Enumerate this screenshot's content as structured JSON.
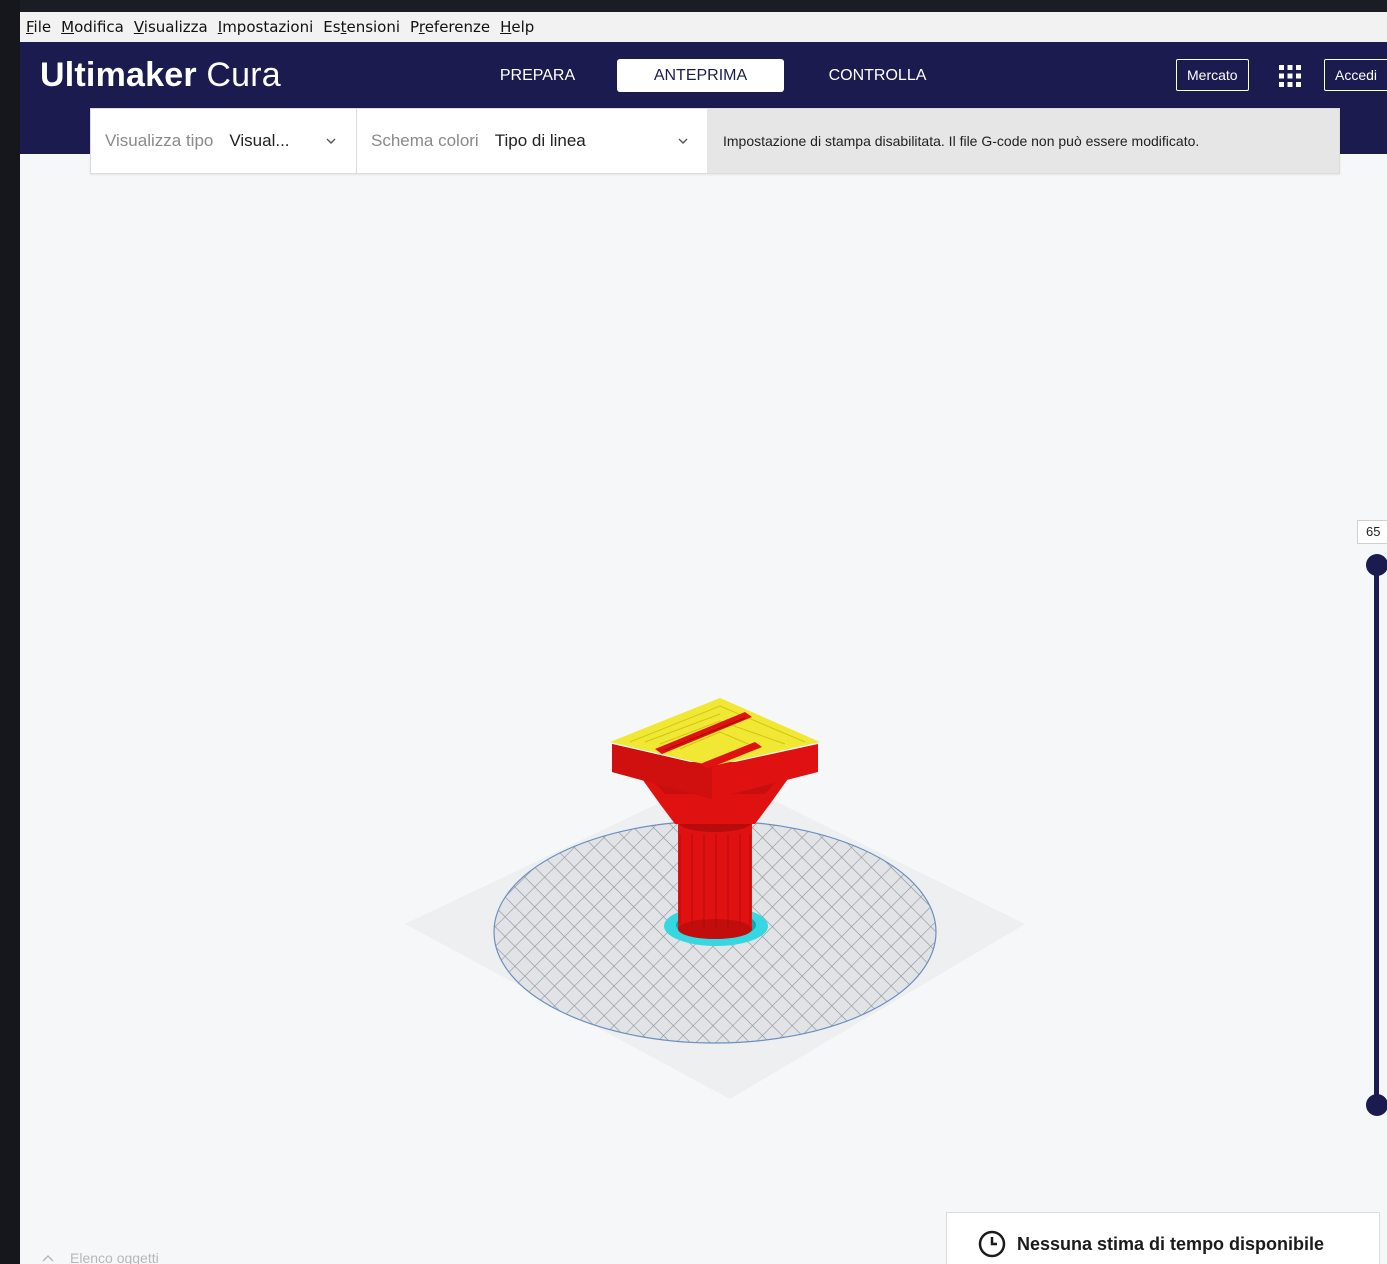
{
  "menubar": {
    "items": [
      {
        "mnemonic": "F",
        "rest": "ile"
      },
      {
        "mnemonic": "M",
        "rest": "odifica"
      },
      {
        "mnemonic": "V",
        "rest": "isualizza"
      },
      {
        "mnemonic": "I",
        "rest": "mpostazioni"
      },
      {
        "pre": "Es",
        "mnemonic": "t",
        "rest": "ensioni"
      },
      {
        "pre": "P",
        "mnemonic": "r",
        "rest": "eferenze"
      },
      {
        "mnemonic": "H",
        "rest": "elp"
      }
    ]
  },
  "header": {
    "logo_bold": "Ultimaker",
    "logo_light": "Cura",
    "stages": [
      "PREPARA",
      "ANTEPRIMA",
      "CONTROLLA"
    ],
    "active_stage": "ANTEPRIMA",
    "marketplace_label": "Mercato",
    "signin_label": "Accedi"
  },
  "view_toolbar": {
    "view_type_label": "Visualizza tipo",
    "view_type_value": "Visual...",
    "color_scheme_label": "Schema colori",
    "color_scheme_value": "Tipo di linea",
    "message": "Impostazione di stampa disabilitata. Il file G-code non può essere modificato."
  },
  "layer_slider": {
    "layer_value": "65"
  },
  "object_list": {
    "label": "Elenco oggetti"
  },
  "print_estimate": {
    "text": "Nessuna stima di tempo disponibile"
  },
  "colors": {
    "header_bg": "#1b1b4f",
    "model_red": "#e01111",
    "model_yellow": "#f0e832",
    "skirt_cyan": "#35d8e0",
    "build_plate_grid": "#9aa0a8"
  }
}
